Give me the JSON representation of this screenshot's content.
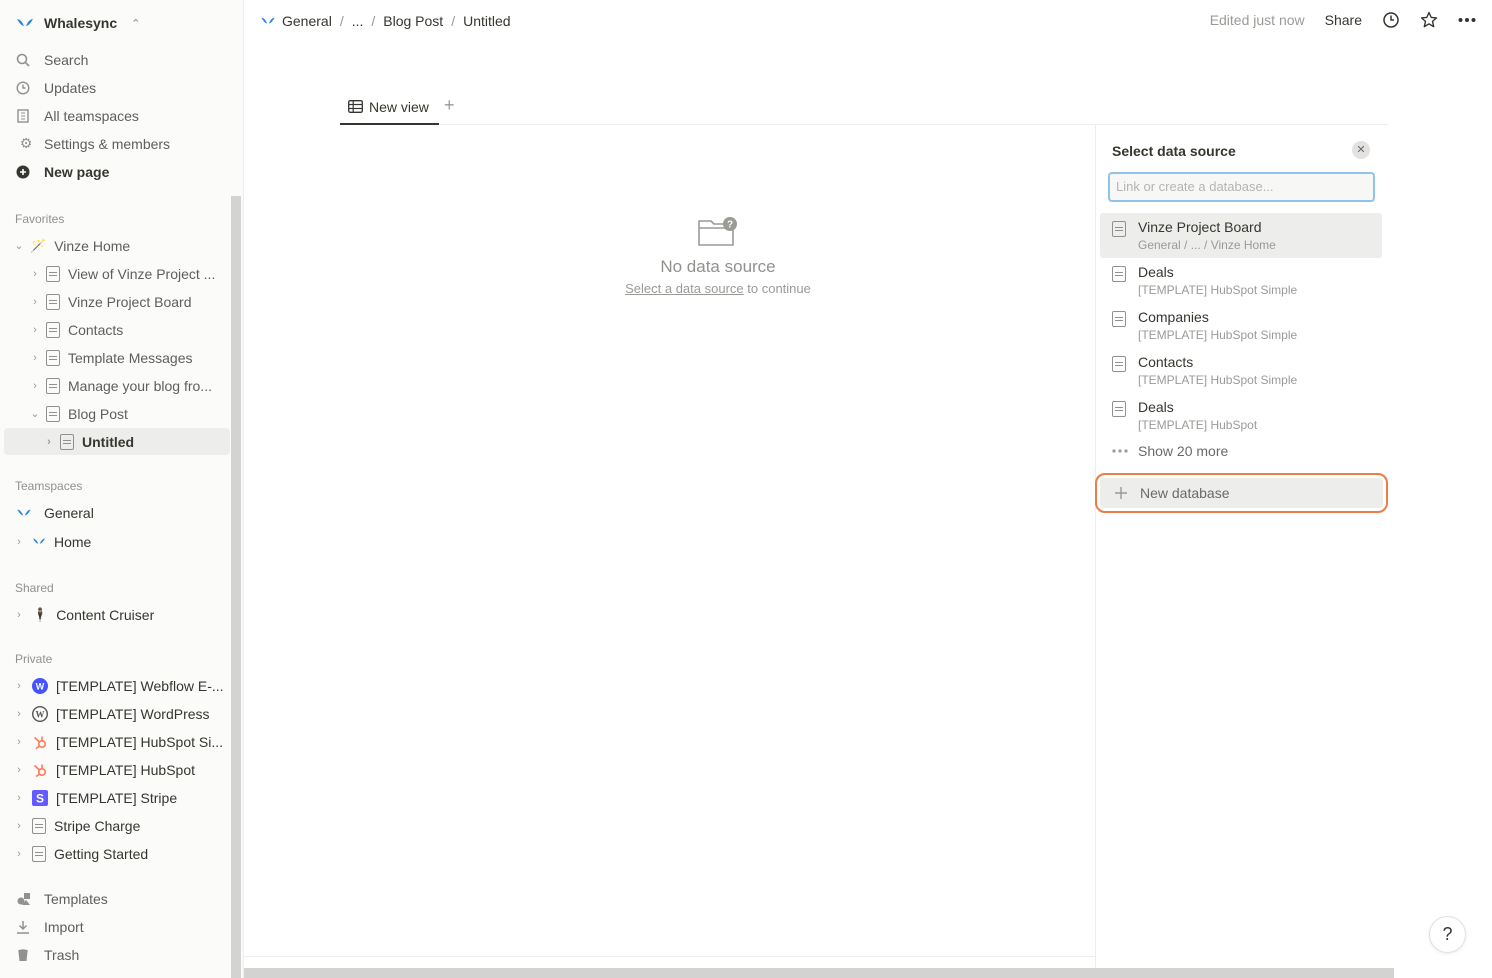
{
  "workspace": {
    "name": "Whalesync"
  },
  "sidebar": {
    "top": [
      {
        "label": "Search",
        "icon": "search-icon"
      },
      {
        "label": "Updates",
        "icon": "clock-icon"
      },
      {
        "label": "All teamspaces",
        "icon": "building-icon"
      },
      {
        "label": "Settings & members",
        "icon": "gear-icon"
      },
      {
        "label": "New page",
        "icon": "plus-circle-icon"
      }
    ],
    "favorites_label": "Favorites",
    "favorites": [
      {
        "label": "Vinze Home",
        "icon": "wand-icon"
      },
      {
        "label": "View of Vinze Project ..."
      },
      {
        "label": "Vinze Project Board"
      },
      {
        "label": "Contacts"
      },
      {
        "label": "Template Messages"
      },
      {
        "label": "Manage your blog fro..."
      },
      {
        "label": "Blog Post"
      },
      {
        "label": "Untitled"
      }
    ],
    "teamspaces_label": "Teamspaces",
    "teamspaces": [
      {
        "label": "General"
      },
      {
        "label": "Home"
      }
    ],
    "shared_label": "Shared",
    "shared": [
      {
        "label": "Content Cruiser"
      }
    ],
    "private_label": "Private",
    "private": [
      {
        "label": "[TEMPLATE] Webflow E-..."
      },
      {
        "label": "[TEMPLATE] WordPress"
      },
      {
        "label": "[TEMPLATE] HubSpot Si..."
      },
      {
        "label": "[TEMPLATE] HubSpot"
      },
      {
        "label": "[TEMPLATE] Stripe"
      },
      {
        "label": "Stripe Charge"
      },
      {
        "label": "Getting Started"
      }
    ],
    "bottom": [
      {
        "label": "Templates"
      },
      {
        "label": "Import"
      },
      {
        "label": "Trash"
      }
    ]
  },
  "breadcrumb": {
    "items": [
      "General",
      "...",
      "Blog Post",
      "Untitled"
    ]
  },
  "topbar": {
    "edited": "Edited just now",
    "share": "Share"
  },
  "view": {
    "tab_label": "New view"
  },
  "empty_state": {
    "title": "No data source",
    "link": "Select a data source",
    "suffix": "to continue"
  },
  "panel": {
    "title": "Select data source",
    "search_placeholder": "Link or create a database...",
    "items": [
      {
        "name": "Vinze Project Board",
        "path": "General / ... / Vinze Home"
      },
      {
        "name": "Deals",
        "path": "[TEMPLATE] HubSpot Simple"
      },
      {
        "name": "Companies",
        "path": "[TEMPLATE] HubSpot Simple"
      },
      {
        "name": "Contacts",
        "path": "[TEMPLATE] HubSpot Simple"
      },
      {
        "name": "Deals",
        "path": "[TEMPLATE] HubSpot"
      }
    ],
    "more": "Show 20 more",
    "new_database": "New database"
  },
  "help": "?",
  "colors": {
    "highlight": "#f07c45",
    "focus": "#8fc3e8",
    "brand": "#2383e2"
  }
}
